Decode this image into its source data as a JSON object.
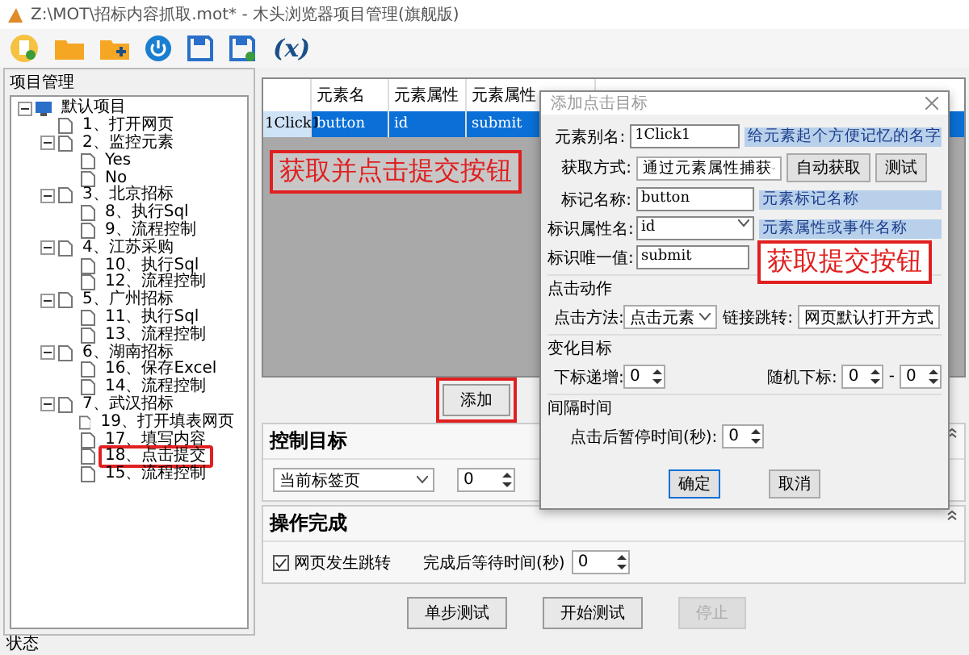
{
  "window": {
    "title": "Z:\\MOT\\招标内容抓取.mot* - 木头浏览器项目管理(旗舰版)"
  },
  "toolbar": {
    "variable_label": "(x)"
  },
  "project_tree": {
    "header": "项目管理",
    "items": [
      {
        "label": "默认项目",
        "expanded": true,
        "children": [
          {
            "label": "1、打开网页"
          },
          {
            "label": "2、监控元素",
            "expanded": true,
            "children": [
              {
                "label": "Yes"
              },
              {
                "label": "No"
              }
            ]
          },
          {
            "label": "3、北京招标",
            "expanded": true,
            "children": [
              {
                "label": "8、执行Sql"
              },
              {
                "label": "9、流程控制"
              }
            ]
          },
          {
            "label": "4、江苏采购",
            "expanded": true,
            "children": [
              {
                "label": "10、执行Sql"
              },
              {
                "label": "12、流程控制"
              }
            ]
          },
          {
            "label": "5、广州招标",
            "expanded": true,
            "children": [
              {
                "label": "11、执行Sql"
              },
              {
                "label": "13、流程控制"
              }
            ]
          },
          {
            "label": "6、湖南招标",
            "expanded": true,
            "children": [
              {
                "label": "16、保存Excel"
              },
              {
                "label": "14、流程控制"
              }
            ]
          },
          {
            "label": "7、武汉招标",
            "expanded": true,
            "children": [
              {
                "label": "19、打开填表网页",
                "marked": false
              },
              {
                "label": "17、填写内容",
                "marked": false
              },
              {
                "label": "18、点击提交",
                "marked": true
              },
              {
                "label": "15、流程控制",
                "marked": false
              }
            ]
          }
        ]
      }
    ]
  },
  "table": {
    "columns": [
      "",
      "元素名",
      "元素属性",
      "元素属性"
    ],
    "rows": [
      {
        "cells": [
          "1Click1",
          "button",
          "id",
          "submit"
        ],
        "selected": true
      }
    ],
    "annotation": "获取并点击提交按钮"
  },
  "add_button": "添加",
  "control_target": {
    "title": "控制目标",
    "target": "当前标签页",
    "index": "0"
  },
  "completion": {
    "title": "操作完成",
    "redirect_label": "网页发生跳转",
    "redirect_checked": true,
    "wait_label": "完成后等待时间(秒)",
    "wait": "0"
  },
  "actions": [
    {
      "label": "单步测试",
      "disabled": false
    },
    {
      "label": "开始测试",
      "disabled": false
    },
    {
      "label": "停止",
      "disabled": true
    }
  ],
  "status_bar": "状态",
  "dialog": {
    "title": "添加点击目标",
    "alias_label": "元素别名:",
    "alias": "1Click1",
    "alias_hint": "给元素起个方便记忆的名字",
    "method_label": "获取方式:",
    "method": "通过元素属性捕获",
    "auto_button": "自动获取",
    "test_button": "测试",
    "tag_label": "标记名称:",
    "tag": "button",
    "tag_hint": "元素标记名称",
    "attr_label": "标识属性名:",
    "attr": "id",
    "attr_hint": "元素属性或事件名称",
    "value_label": "标识唯一值:",
    "value": "submit",
    "annotation": "获取提交按钮",
    "click_group": "点击动作",
    "click_label": "点击方法:",
    "click": "点击元素",
    "link_label": "链接跳转:",
    "link": "网页默认打开方式",
    "change_group": "变化目标",
    "inc_label": "下标递增:",
    "inc": "0",
    "rand_label": "随机下标:",
    "rand_from": "0",
    "rand_sep": "-",
    "rand_to": "0",
    "interval_group": "间隔时间",
    "pause_label": "点击后暂停时间(秒):",
    "pause": "0",
    "ok": "确定",
    "cancel": "取消"
  }
}
